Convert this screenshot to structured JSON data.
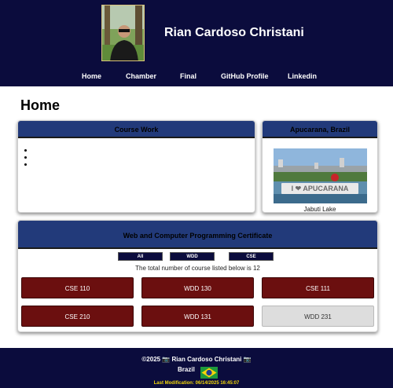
{
  "header": {
    "name": "Rian Cardoso Christani",
    "nav": [
      "Home",
      "Chamber",
      "Final",
      "GitHub Profile",
      "Linkedin"
    ]
  },
  "main": {
    "title": "Home",
    "coursework": {
      "title": "Course Work"
    },
    "city": {
      "title": "Apucarana, Brazil",
      "caption": "Jabuti Lake",
      "sign_text": "I ❤ APUCARANA"
    },
    "certificate": {
      "title": "Web and Computer Programming Certificate",
      "filters": [
        "All",
        "WDD",
        "CSE"
      ],
      "count_text": "The total number of course listed below is 12",
      "courses": [
        {
          "code": "CSE 110",
          "completed": true
        },
        {
          "code": "WDD 130",
          "completed": true
        },
        {
          "code": "CSE 111",
          "completed": true
        },
        {
          "code": "CSE 210",
          "completed": true
        },
        {
          "code": "WDD 131",
          "completed": true
        },
        {
          "code": "WDD 231",
          "completed": false
        }
      ]
    }
  },
  "footer": {
    "copyright": "©2025 📷 Rian Cardoso Christani 📷",
    "country": "Brazil",
    "last_modified": "Last Modification: 06/14/2025 16:45:07"
  },
  "colors": {
    "navy": "#0b0c3d",
    "card_header": "#223a7a",
    "completed_course": "#6b0f0f",
    "pending_course": "#dddddd",
    "last_mod_text": "#f2d60a"
  }
}
